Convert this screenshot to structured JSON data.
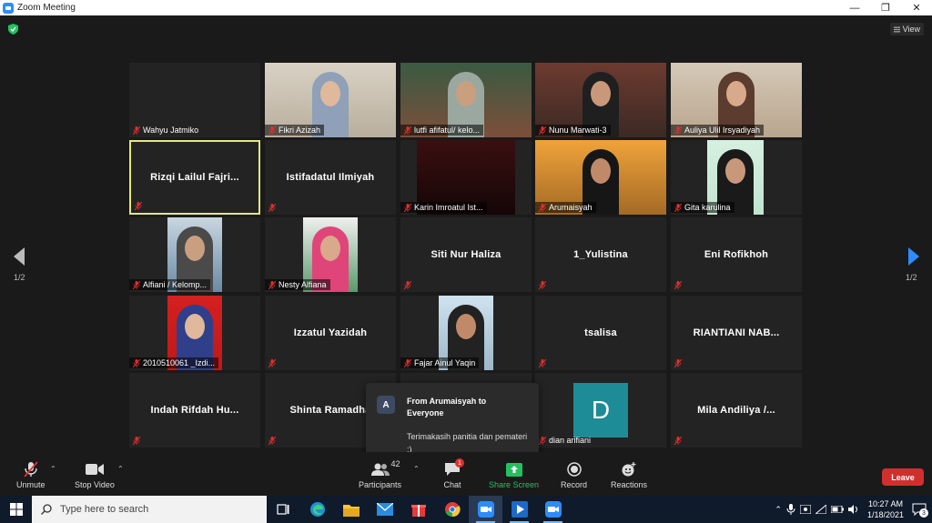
{
  "window": {
    "title": "Zoom Meeting",
    "minimize": "—",
    "restore": "❐",
    "close": "✕"
  },
  "view_button": {
    "label": "View"
  },
  "pagination": {
    "left": "1/2",
    "right": "1/2"
  },
  "tiles": [
    {
      "name": "Wahyu Jatmiko",
      "video": false,
      "center": ""
    },
    {
      "name": "Fikri Azizah",
      "video": true,
      "center": ""
    },
    {
      "name": "lutfi afifatul/ kelo...",
      "video": true,
      "center": ""
    },
    {
      "name": "Nunu Marwati-3",
      "video": true,
      "center": ""
    },
    {
      "name": "Auliya Ulil Irsyadiyah",
      "video": true,
      "center": ""
    },
    {
      "name": "",
      "video": false,
      "center": "Rizqi  Lailul  Fajri..."
    },
    {
      "name": "",
      "video": false,
      "center": "Istifadatul Ilmiyah"
    },
    {
      "name": "Karin Imroatul Ist...",
      "video": true,
      "center": ""
    },
    {
      "name": "Arumaisyah",
      "video": true,
      "center": ""
    },
    {
      "name": "Gita karulina",
      "video": true,
      "center": ""
    },
    {
      "name": "Alfiani / Kelomp...",
      "video": true,
      "center": ""
    },
    {
      "name": "Nesty Alfiana",
      "video": true,
      "center": ""
    },
    {
      "name": "",
      "video": false,
      "center": "Siti Nur Haliza"
    },
    {
      "name": "",
      "video": false,
      "center": "1_Yulistina"
    },
    {
      "name": "",
      "video": false,
      "center": "Eni Rofikhoh"
    },
    {
      "name": "2010510061 _Izdi...",
      "video": true,
      "center": ""
    },
    {
      "name": "",
      "video": false,
      "center": "Izzatul Yazidah"
    },
    {
      "name": "Fajar Ainul Yaqin",
      "video": true,
      "center": ""
    },
    {
      "name": "",
      "video": false,
      "center": "tsalisa"
    },
    {
      "name": "",
      "video": false,
      "center": "RIANTIANI NAB..."
    },
    {
      "name": "",
      "video": false,
      "center": "Indah  Rifdah  Hu..."
    },
    {
      "name": "",
      "video": false,
      "center": "Shinta Ramadha"
    },
    {
      "name": "",
      "video": false,
      "center": ""
    },
    {
      "name": "dian arifiani",
      "video": false,
      "center": "",
      "avatar_letter": "D"
    },
    {
      "name": "",
      "video": false,
      "center": "Mila  Andiliya  /..."
    }
  ],
  "chat_popup": {
    "avatar_letter": "A",
    "from": "From Arumaisyah to Everyone",
    "message": "Terimakasih panitia dan pemateri :)"
  },
  "toolbar": {
    "unmute": "Unmute",
    "stop_video": "Stop Video",
    "participants": "Participants",
    "participants_count": "42",
    "chat": "Chat",
    "chat_badge": "1",
    "share_screen": "Share Screen",
    "record": "Record",
    "reactions": "Reactions",
    "leave": "Leave"
  },
  "taskbar": {
    "search_placeholder": "Type here to search",
    "time": "10:27 AM",
    "date": "1/18/2021",
    "notif_count": "3"
  },
  "colors": {
    "accent": "#2d8cff",
    "active_speaker": "#e5e87a",
    "leave": "#d0302d",
    "share": "#23c060",
    "avatar_d": "#1e8c96"
  }
}
